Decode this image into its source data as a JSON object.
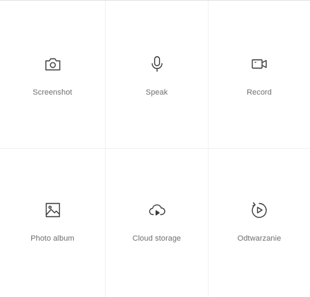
{
  "actions": [
    {
      "label": "Screenshot",
      "icon": "camera-icon"
    },
    {
      "label": "Speak",
      "icon": "microphone-icon"
    },
    {
      "label": "Record",
      "icon": "video-camera-icon"
    },
    {
      "label": "Photo album",
      "icon": "image-icon"
    },
    {
      "label": "Cloud storage",
      "icon": "cloud-play-icon"
    },
    {
      "label": "Odtwarzanie",
      "icon": "replay-icon"
    }
  ],
  "colors": {
    "icon": "#3a3a3a",
    "label": "#6d6d6d",
    "divider": "#f0f0f0",
    "background": "#ffffff"
  }
}
